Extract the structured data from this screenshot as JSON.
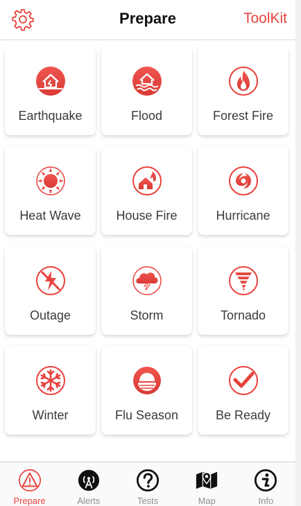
{
  "header": {
    "title": "Prepare",
    "toolkit_label": "ToolKit"
  },
  "tiles": [
    {
      "label": "Earthquake"
    },
    {
      "label": "Flood"
    },
    {
      "label": "Forest Fire"
    },
    {
      "label": "Heat Wave"
    },
    {
      "label": "House Fire"
    },
    {
      "label": "Hurricane"
    },
    {
      "label": "Outage"
    },
    {
      "label": "Storm"
    },
    {
      "label": "Tornado"
    },
    {
      "label": "Winter"
    },
    {
      "label": "Flu Season"
    },
    {
      "label": "Be Ready"
    }
  ],
  "tabs": [
    {
      "label": "Prepare"
    },
    {
      "label": "Alerts"
    },
    {
      "label": "Tests"
    },
    {
      "label": "Map"
    },
    {
      "label": "Info"
    }
  ],
  "colors": {
    "accent": "#e8413c",
    "inactive": "#8e8e8e"
  }
}
